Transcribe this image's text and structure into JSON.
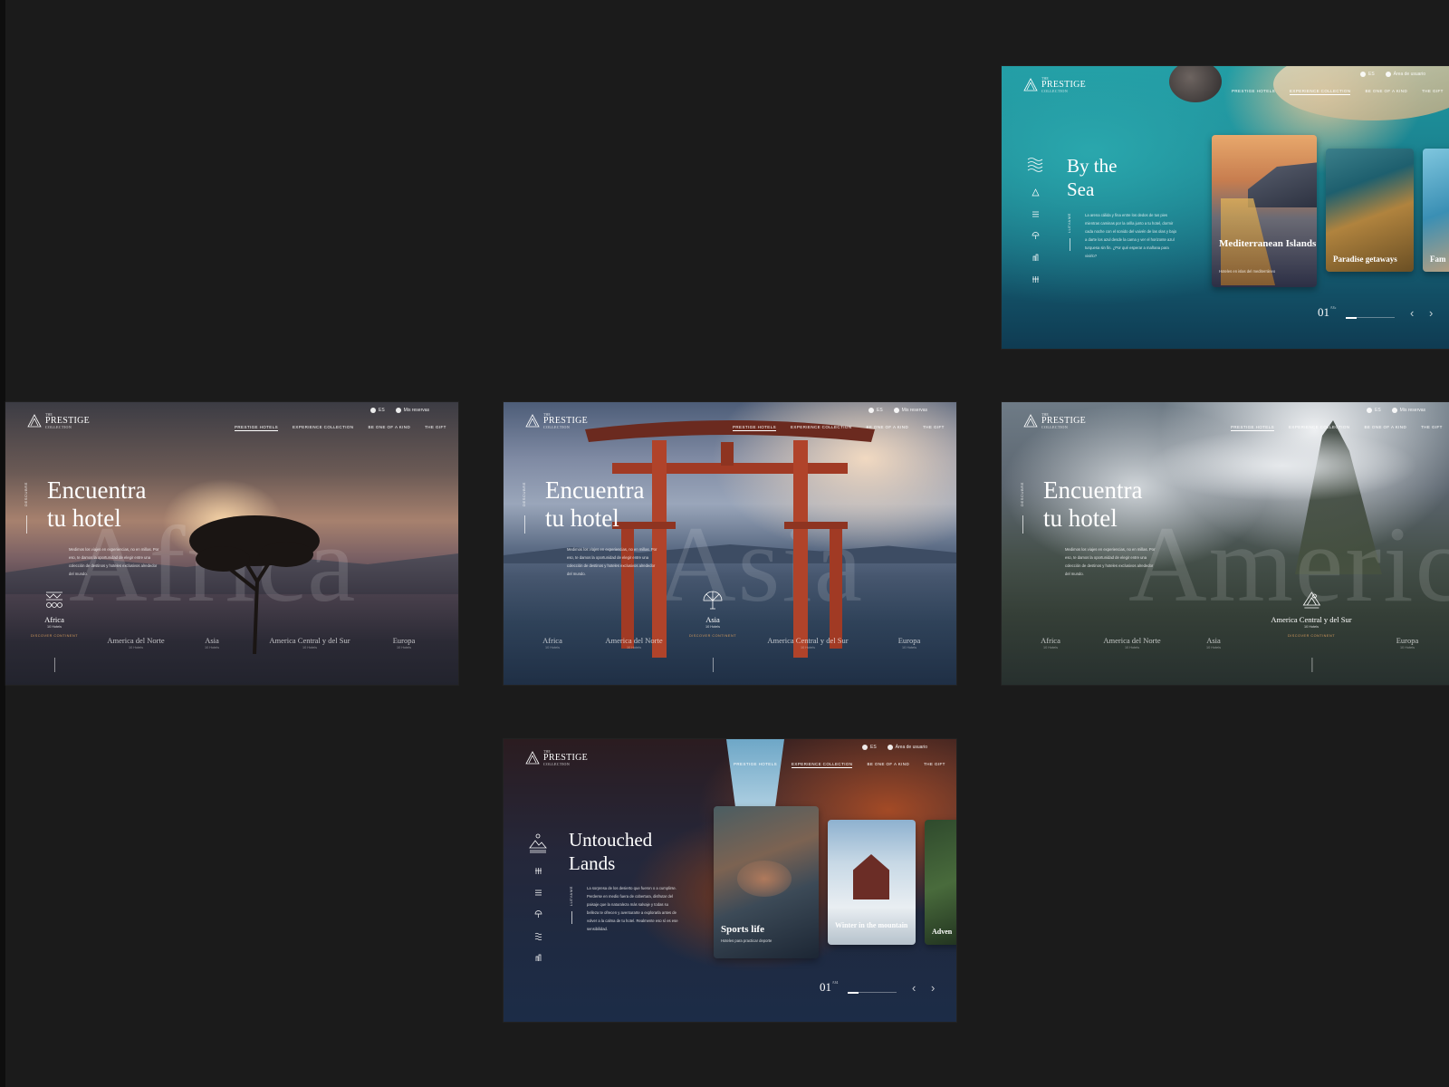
{
  "common": {
    "logo": {
      "the": "THE",
      "name": "PRESTIGE",
      "collection": "COLLECTION"
    },
    "lang": "ES",
    "nav": [
      "PRESTIGE HOTELS",
      "EXPERIENCE COLLECTION",
      "BE ONE OF A KIND",
      "THE GIFT"
    ]
  },
  "sea": {
    "user": "Área de usuario",
    "title_l1": "By the",
    "title_l2": "Sea",
    "vertical": "LLEVAME",
    "para": "La arena cálida y fina entre los dedos de tus pies mientras caminas por la orilla junto a tu hotel, dormir cada noche con el sonido del vaivén de las olas y bajo a darte los azul desde la cama y ver el horizonte azul turquesa sin fin. ¿Por qué esperar a mañana para vivirlo?",
    "cards": [
      {
        "title": "Mediterranean Islands",
        "sub": "Hoteles en islas del mediterráneo"
      },
      {
        "title": "Paradise getaways",
        "sub": ""
      },
      {
        "title": "Fam",
        "sub": ""
      }
    ],
    "counter": "01",
    "total": "/05"
  },
  "africa": {
    "user": "Mis reservas",
    "title_l1": "Encuentra",
    "title_l2": "tu hotel",
    "vertical": "DESCUBRE",
    "watermark": "Africa",
    "para": "Medimos los viajes en experiencias, no en millas. Por eso, te damos la oportunidad de elegir entre una colección de destinos y hoteles exclusivos alrededor del mundo.",
    "continents": [
      {
        "name": "Africa",
        "count": "10 Hotels",
        "discover": "DISCOVER CONTINENT"
      },
      {
        "name": "America del Norte",
        "count": "10 Hotels"
      },
      {
        "name": "Asia",
        "count": "10 Hotels"
      },
      {
        "name": "America Central y del Sur",
        "count": "10 Hotels"
      },
      {
        "name": "Europa",
        "count": "10 Hotels"
      }
    ]
  },
  "asia": {
    "user": "Mis reservas",
    "title_l1": "Encuentra",
    "title_l2": "tu hotel",
    "vertical": "DESCUBRE",
    "watermark": "Asia",
    "para": "Medimos los viajes en experiencias, no en millas. Por eso, te damos la oportunidad de elegir entre una colección de destinos y hoteles exclusivos alrededor del mundo.",
    "continents": [
      {
        "name": "Africa",
        "count": "10 Hotels"
      },
      {
        "name": "America del Norte",
        "count": "10 Hotels"
      },
      {
        "name": "Asia",
        "count": "10 Hotels",
        "discover": "DISCOVER CONTINENT"
      },
      {
        "name": "America Central y del Sur",
        "count": "10 Hotels"
      },
      {
        "name": "Europa",
        "count": "10 Hotels"
      }
    ]
  },
  "america": {
    "user": "Mis reservas",
    "title_l1": "Encuentra",
    "title_l2": "tu hotel",
    "vertical": "DESCUBRE",
    "watermark": "America",
    "para": "Medimos los viajes en experiencias, no en millas. Por eso, te damos la oportunidad de elegir entre una colección de destinos y hoteles exclusivos alrededor del mundo.",
    "continents": [
      {
        "name": "Africa",
        "count": "10 Hotels"
      },
      {
        "name": "America del Norte",
        "count": "10 Hotels"
      },
      {
        "name": "Asia",
        "count": "10 Hotels"
      },
      {
        "name": "America Central y del Sur",
        "count": "10 Hotels",
        "discover": "DISCOVER CONTINENT"
      },
      {
        "name": "Europa",
        "count": "10 Hotels"
      }
    ]
  },
  "lands": {
    "user": "Área de usuario",
    "title_l1": "Untouched",
    "title_l2": "Lands",
    "vertical": "LLEVAME",
    "para": "La sorpresa de los desierto que fueron o a cumplirse. Perderse en medio fuera de cobertura, disfrutar del paisaje que la naturaleza más salvaje y todas su belleza te ofrecen y aventurarte a explorarla antes de volver a la calma de tu hotel. Realmente eso sí es ese sensibilidad.",
    "cards": [
      {
        "title": "Sports life",
        "sub": "Hoteles para practicar deporte"
      },
      {
        "title": "Winter in the mountain",
        "sub": ""
      },
      {
        "title": "Adven",
        "sub": ""
      }
    ],
    "counter": "01",
    "total": "/04"
  },
  "colors": {
    "accent": "#d39a5c",
    "page_bg": "#1b1b1b"
  }
}
